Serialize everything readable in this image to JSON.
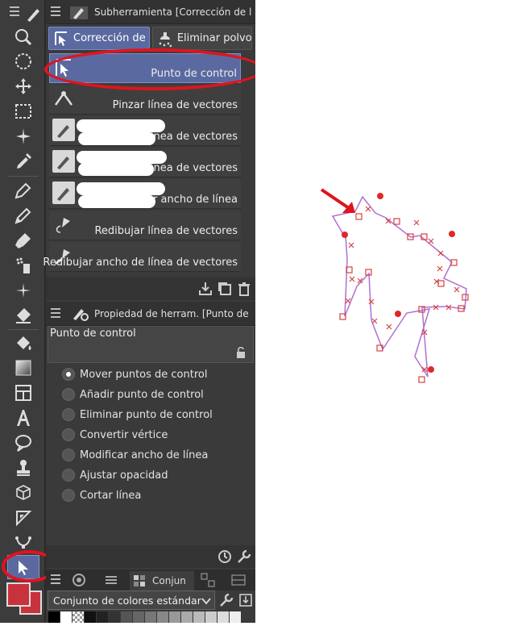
{
  "subtool_panel": {
    "title": "Subherramienta [Corrección de líne",
    "tabs": [
      {
        "label": "Corrección de l"
      },
      {
        "label": "Eliminar polvo"
      }
    ],
    "items": [
      {
        "label": "Punto de control",
        "icon": "control-point-arrow-icon",
        "selected": true
      },
      {
        "label": "Pinzar línea de vectores",
        "icon": "pinch-vector-icon"
      },
      {
        "label": "Simplificar línea de vectores",
        "icon": "simplify-vector-icon"
      },
      {
        "label": "Conectar línea de vectores",
        "icon": "connect-vector-icon"
      },
      {
        "label": "Corregir ancho de línea",
        "icon": "correct-line-width-icon"
      },
      {
        "label": "Redibujar línea de vectores",
        "icon": "redraw-vector-icon"
      },
      {
        "label": "Redibujar ancho de línea de vectores",
        "icon": "redraw-line-width-icon"
      }
    ]
  },
  "property_panel": {
    "title": "Propiedad de herram. [Punto de con",
    "tool_name": "Punto de control",
    "options": [
      {
        "label": "Mover puntos de control",
        "selected": true
      },
      {
        "label": "Añadir punto de control",
        "selected": false
      },
      {
        "label": "Eliminar punto de control",
        "selected": false
      },
      {
        "label": "Convertir vértice",
        "selected": false
      },
      {
        "label": "Modificar ancho de línea",
        "selected": false
      },
      {
        "label": "Ajustar opacidad",
        "selected": false
      },
      {
        "label": "Cortar línea",
        "selected": false
      }
    ]
  },
  "color_panel": {
    "tab_label": "Conjun",
    "set_select": "Conjunto de colores estándar"
  },
  "colors": {
    "main_color": "#c8323c",
    "sub_color": "#c8323c",
    "highlight": "#e0141e",
    "selection_blue": "#5a6aa0",
    "vector_line": "#b070d0"
  }
}
